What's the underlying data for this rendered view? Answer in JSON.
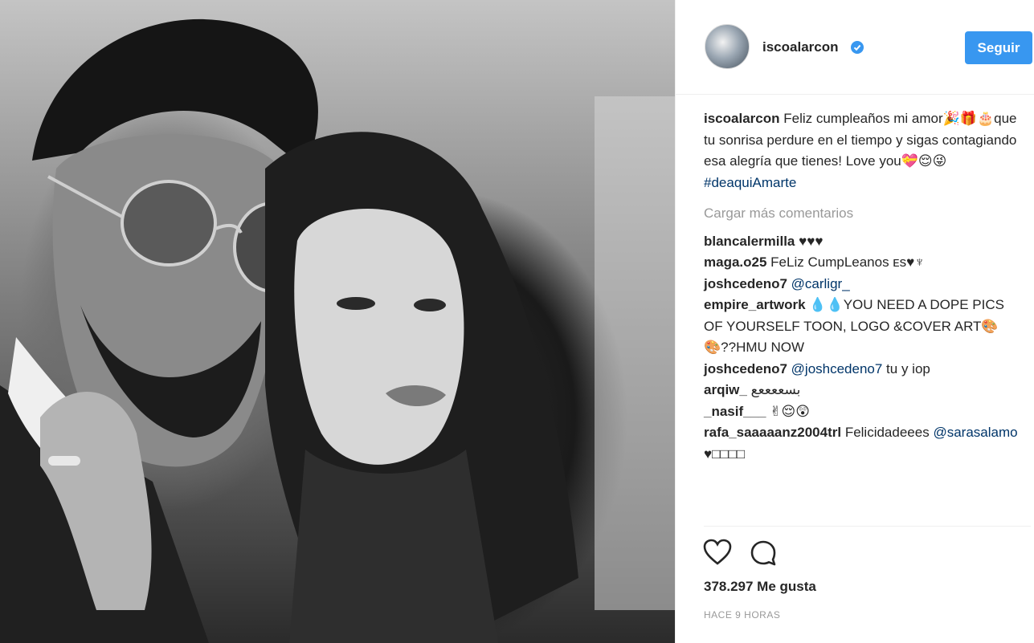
{
  "post": {
    "photo_alt": "Black and white selfie of a couple",
    "username": "iscoalarcon",
    "verified_icon": "verified-badge-icon",
    "follow_label": "Seguir",
    "accent_color": "#3897f0"
  },
  "caption": {
    "username": "iscoalarcon",
    "text": "Feliz cumpleaños mi amor🎉🎁🎂que tu sonrisa perdure en el tiempo y sigas contagiando esa alegría que tienes! Love you💝😌😜",
    "hashtag": "#deaquiAmarte"
  },
  "load_more": "Cargar más comentarios",
  "comments": [
    {
      "user": "blancalermilla",
      "text": "♥♥♥",
      "mention": ""
    },
    {
      "user": "maga.o25",
      "text": "FeLiz CumpLeanos ᴇs♥♆",
      "mention": ""
    },
    {
      "user": "joshcedeno7",
      "text": "",
      "mention": "@carligr_"
    },
    {
      "user": "empire_artwork",
      "text": "💧💧YOU NEED A DOPE PICS OF YOURSELF TOON, LOGO &COVER ART🎨🎨??HMU NOW",
      "mention": ""
    },
    {
      "user": "joshcedeno7",
      "text": " tu y iop",
      "mention": "@joshcedeno7",
      "mention_first": true
    },
    {
      "user": "arqiw_",
      "text": "بسععععع",
      "mention": ""
    },
    {
      "user": "_nasif___",
      "text": "✌😌😲",
      "mention": ""
    },
    {
      "user": "rafa_saaaaanz2004trl",
      "text": "Felicidadeees",
      "mention": "@sarasalamo",
      "suffix": " ♥□□□□"
    }
  ],
  "actions": {
    "like_icon": "heart-icon",
    "comment_icon": "comment-icon",
    "likes_text": "378.297 Me gusta",
    "time_text": "HACE 9 HORAS"
  }
}
